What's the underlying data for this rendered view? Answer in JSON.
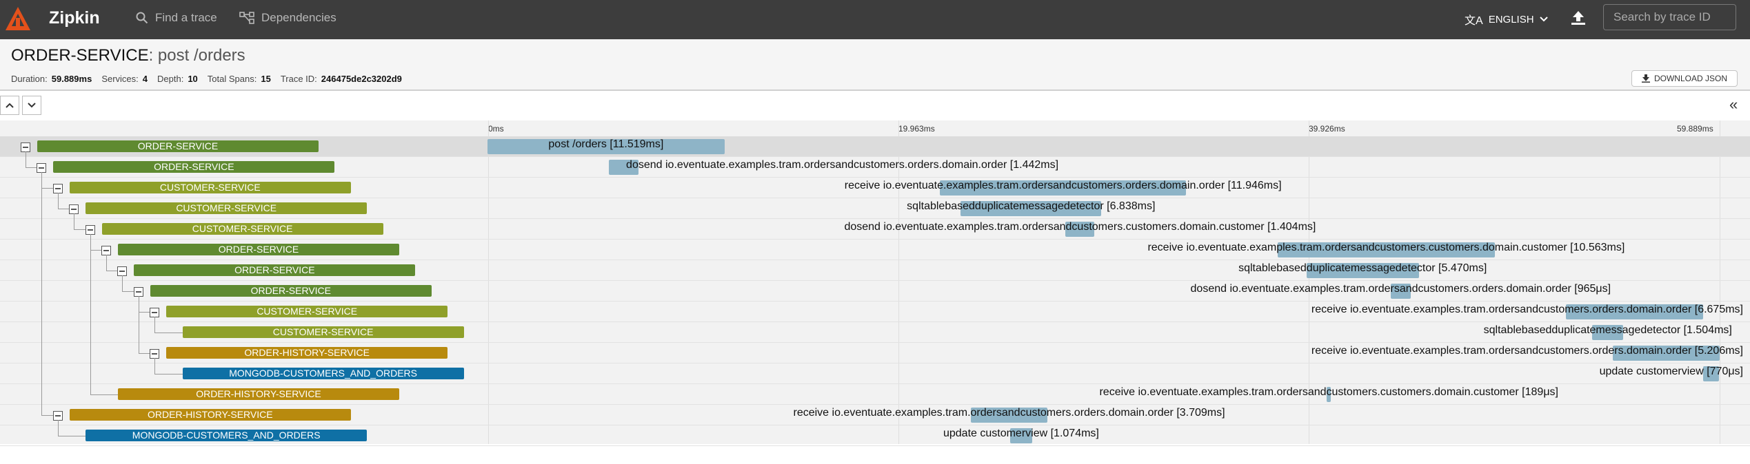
{
  "app": {
    "brand": "Zipkin",
    "nav_find": "Find a trace",
    "nav_deps": "Dependencies",
    "language": "ENGLISH",
    "search_placeholder": "Search by trace ID",
    "icons": [
      "zipkin-logo-icon",
      "search-icon",
      "dependencies-icon",
      "translate-icon",
      "chevron-down-icon",
      "upload-icon",
      "download-icon"
    ]
  },
  "trace": {
    "service": "ORDER-SERVICE",
    "span": ": post /orders",
    "duration_label": "Duration:",
    "duration": "59.889ms",
    "services_label": "Services:",
    "services": "4",
    "depth_label": "Depth:",
    "depth": "10",
    "spans_label": "Total Spans:",
    "spans": "15",
    "traceid_label": "Trace ID:",
    "traceid": "246475de2c3202d9",
    "download": "DOWNLOAD JSON"
  },
  "timeline": {
    "ticks": [
      "0ms",
      "19.963ms",
      "39.926ms",
      "59.889ms"
    ],
    "total_ms": 59.889,
    "colors": {
      "ORDER-SERVICE": "#5f8a30",
      "CUSTOMER-SERVICE": "#8fa02a",
      "ORDER-HISTORY-SERVICE": "#b88a0e",
      "MONGODB-CUSTOMERS_AND_ORDERS": "#0f70a5"
    },
    "rows": [
      {
        "service": "ORDER-SERVICE",
        "depth": 0,
        "toggle": true,
        "start": 0,
        "dur": 11.519,
        "label": "post /orders [11.519ms]"
      },
      {
        "service": "ORDER-SERVICE",
        "depth": 1,
        "toggle": true,
        "start": 5.9,
        "dur": 1.442,
        "label": "dosend io.eventuate.examples.tram.ordersandcustomers.orders.domain.order [1.442ms]"
      },
      {
        "service": "CUSTOMER-SERVICE",
        "depth": 2,
        "toggle": true,
        "start": 22.0,
        "dur": 11.946,
        "label": "receive io.eventuate.examples.tram.ordersandcustomers.orders.domain.order [11.946ms]"
      },
      {
        "service": "CUSTOMER-SERVICE",
        "depth": 3,
        "toggle": true,
        "start": 23.0,
        "dur": 6.838,
        "label": "sqltablebasedduplicatemessagedetector [6.838ms]"
      },
      {
        "service": "CUSTOMER-SERVICE",
        "depth": 4,
        "toggle": true,
        "start": 28.1,
        "dur": 1.404,
        "label": "dosend io.eventuate.examples.tram.ordersandcustomers.customers.domain.customer [1.404ms]"
      },
      {
        "service": "ORDER-SERVICE",
        "depth": 5,
        "toggle": true,
        "start": 38.4,
        "dur": 10.563,
        "label": "receive io.eventuate.examples.tram.ordersandcustomers.customers.domain.customer [10.563ms]"
      },
      {
        "service": "ORDER-SERVICE",
        "depth": 6,
        "toggle": true,
        "start": 39.8,
        "dur": 5.47,
        "label": "sqltablebasedduplicatemessagedetector [5.470ms]"
      },
      {
        "service": "ORDER-SERVICE",
        "depth": 7,
        "toggle": true,
        "start": 43.9,
        "dur": 0.965,
        "label": "dosend io.eventuate.examples.tram.ordersandcustomers.orders.domain.order [965μs]"
      },
      {
        "service": "CUSTOMER-SERVICE",
        "depth": 8,
        "toggle": true,
        "start": 52.4,
        "dur": 6.675,
        "label": "receive io.eventuate.examples.tram.ordersandcustomers.orders.domain.order [6.675ms]"
      },
      {
        "service": "CUSTOMER-SERVICE",
        "depth": 9,
        "toggle": false,
        "start": 53.7,
        "dur": 1.504,
        "label": "sqltablebasedduplicatemessagedetector [1.504ms]"
      },
      {
        "service": "ORDER-HISTORY-SERVICE",
        "depth": 8,
        "toggle": true,
        "start": 54.7,
        "dur": 5.206,
        "label": "receive io.eventuate.examples.tram.ordersandcustomers.orders.domain.order [5.206ms]"
      },
      {
        "service": "MONGODB-CUSTOMERS_AND_ORDERS",
        "depth": 9,
        "toggle": false,
        "start": 59.1,
        "dur": 0.77,
        "label": "update customerview [770μs]"
      },
      {
        "service": "ORDER-HISTORY-SERVICE",
        "depth": 5,
        "toggle": false,
        "start": 40.8,
        "dur": 0.189,
        "label": "receive io.eventuate.examples.tram.ordersandcustomers.customers.domain.customer [189μs]"
      },
      {
        "service": "ORDER-HISTORY-SERVICE",
        "depth": 2,
        "toggle": true,
        "start": 23.5,
        "dur": 3.709,
        "label": "receive io.eventuate.examples.tram.ordersandcustomers.orders.domain.order [3.709ms]"
      },
      {
        "service": "MONGODB-CUSTOMERS_AND_ORDERS",
        "depth": 3,
        "toggle": false,
        "start": 25.4,
        "dur": 1.074,
        "label": "update customerview [1.074ms]"
      }
    ]
  }
}
